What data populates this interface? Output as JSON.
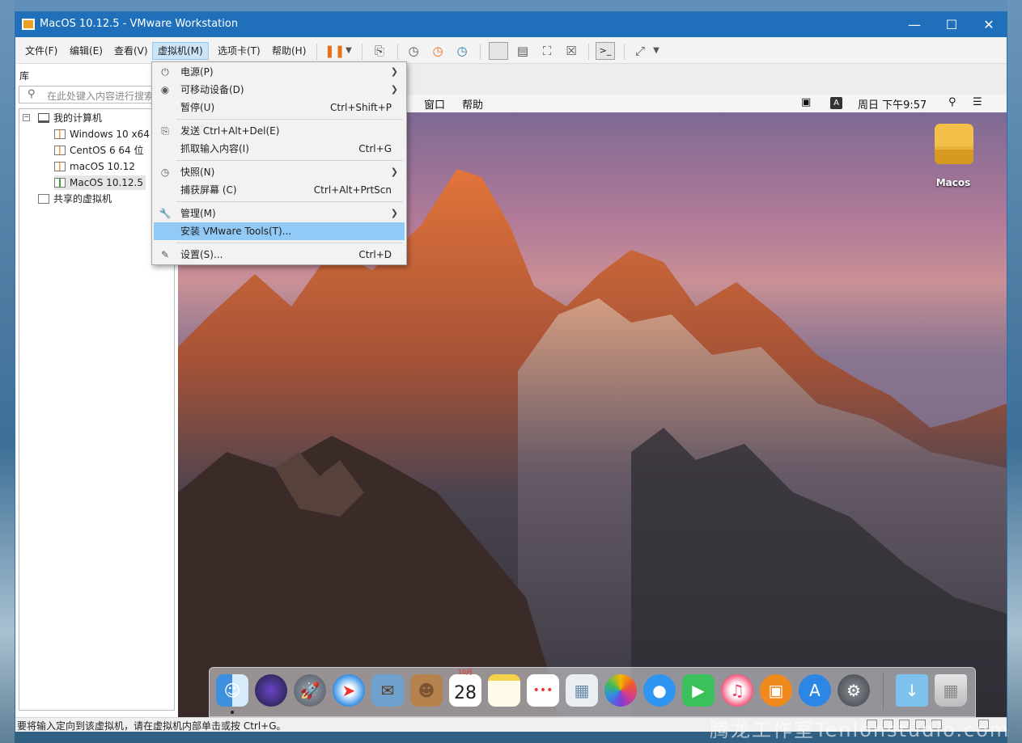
{
  "window": {
    "title": "MacOS 10.12.5 - VMware Workstation"
  },
  "menubar": {
    "items": [
      {
        "label": "文件(F)"
      },
      {
        "label": "编辑(E)"
      },
      {
        "label": "查看(V)"
      },
      {
        "label": "虚拟机(M)"
      },
      {
        "label": "选项卡(T)"
      },
      {
        "label": "帮助(H)"
      }
    ]
  },
  "library": {
    "title": "库",
    "search_placeholder": "在此处键入内容进行搜索",
    "tree": {
      "root": "我的计算机",
      "vms": [
        "Windows 10 x64",
        "CentOS 6 64 位",
        "macOS 10.12",
        "MacOS 10.12.5"
      ],
      "shared": "共享的虚拟机"
    }
  },
  "vm_menu": {
    "items": [
      {
        "label": "电源(P)",
        "shortcut": "",
        "submenu": true,
        "icon": "power-icon"
      },
      {
        "label": "可移动设备(D)",
        "shortcut": "",
        "submenu": true,
        "icon": "removable-device-icon"
      },
      {
        "label": "暂停(U)",
        "shortcut": "Ctrl+Shift+P",
        "submenu": false,
        "icon": ""
      },
      {
        "label": "发送 Ctrl+Alt+Del(E)",
        "shortcut": "",
        "submenu": false,
        "icon": "send-keys-icon"
      },
      {
        "label": "抓取输入内容(I)",
        "shortcut": "Ctrl+G",
        "submenu": false,
        "icon": ""
      },
      {
        "label": "快照(N)",
        "shortcut": "",
        "submenu": true,
        "icon": "snapshot-icon"
      },
      {
        "label": "捕获屏幕 (C)",
        "shortcut": "Ctrl+Alt+PrtScn",
        "submenu": false,
        "icon": ""
      },
      {
        "label": "管理(M)",
        "shortcut": "",
        "submenu": true,
        "icon": "wrench-icon"
      },
      {
        "label": "安装 VMware Tools(T)...",
        "shortcut": "",
        "submenu": false,
        "icon": "",
        "highlighted": true
      },
      {
        "label": "设置(S)...",
        "shortcut": "Ctrl+D",
        "submenu": false,
        "icon": "settings-icon"
      }
    ]
  },
  "mac": {
    "menu_items": [
      "窗口",
      "帮助"
    ],
    "input_source": "A",
    "clock": "周日 下午9:57",
    "desktop_drive_label": "Macos",
    "calendar_day": "28",
    "calendar_month": "10月"
  },
  "statusbar": {
    "text": "要将输入定向到该虚拟机，请在虚拟机内部单击或按 Ctrl+G。"
  },
  "watermark": "腾龙工作室Tenlonstudio.com",
  "colors": {
    "titlebar": "#1f6fba",
    "menu_highlight": "#91c9f7",
    "active_menu": "#cce4f7"
  }
}
